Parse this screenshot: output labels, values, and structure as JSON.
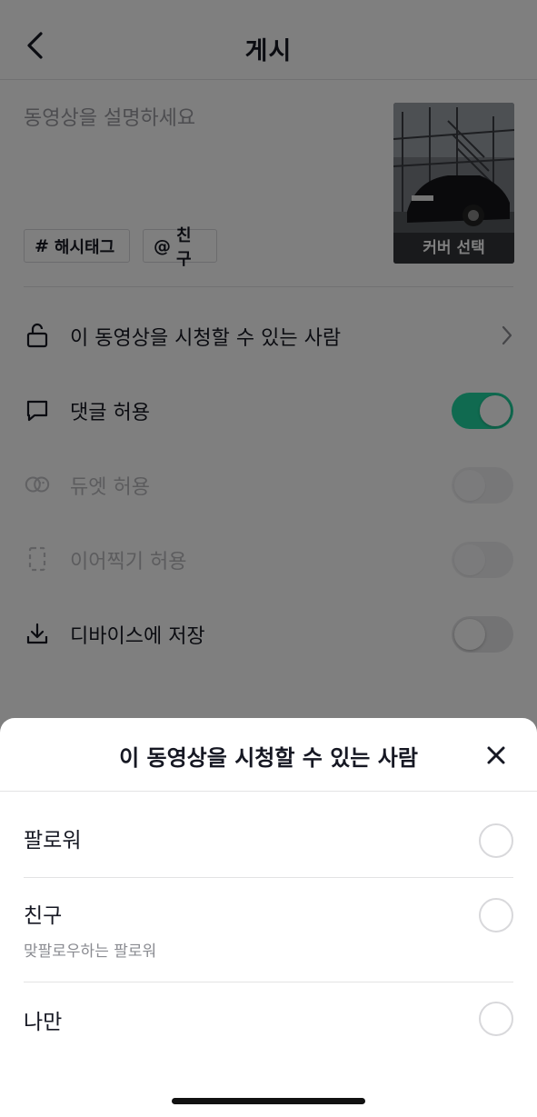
{
  "header": {
    "title": "게시",
    "back_icon": "chevron-left-icon"
  },
  "description": {
    "placeholder": "동영상을 설명하세요"
  },
  "chips": [
    {
      "symbol": "#",
      "label": "해시태그",
      "icon": "hashtag-icon"
    },
    {
      "symbol": "@",
      "label": "친구",
      "icon": "at-icon"
    }
  ],
  "cover": {
    "label": "커버 선택"
  },
  "settings": [
    {
      "label": "이 동영상을 시청할 수 있는 사람",
      "icon": "lock-open-icon",
      "control": "chevron-right-icon"
    },
    {
      "label": "댓글 허용",
      "icon": "comment-icon",
      "toggle": "on"
    },
    {
      "label": "듀엣 허용",
      "icon": "duet-icon",
      "toggle": "off",
      "disabled": true
    },
    {
      "label": "이어찍기 허용",
      "icon": "stitch-icon",
      "toggle": "off",
      "disabled": true
    },
    {
      "label": "디바이스에 저장",
      "icon": "download-icon",
      "toggle": "off"
    }
  ],
  "sheet": {
    "title": "이 동영상을 시청할 수 있는 사람",
    "close_icon": "close-icon",
    "options": [
      {
        "label": "팔로워",
        "sublabel": ""
      },
      {
        "label": "친구",
        "sublabel": "맞팔로우하는 팔로워"
      },
      {
        "label": "나만",
        "sublabel": ""
      }
    ]
  },
  "colors": {
    "toggle_on": "#20d5a0",
    "overlay": "rgba(0,0,0,0.5)"
  }
}
